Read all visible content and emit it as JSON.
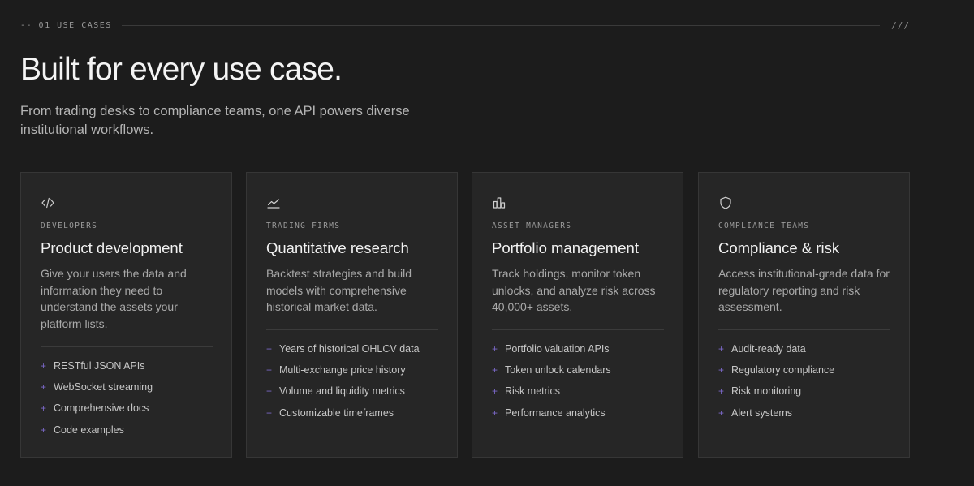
{
  "section": {
    "label": "-- 01 USE CASES",
    "mark": "///"
  },
  "hero": {
    "title": "Built for every use case.",
    "subtitle": "From trading desks to compliance teams, one API powers diverse institutional workflows."
  },
  "colors": {
    "background": "#1c1c1c",
    "card_background": "#262626",
    "accent": "#7b68c8"
  },
  "cards": [
    {
      "icon": "code-icon",
      "eyebrow": "DEVELOPERS",
      "title": "Product development",
      "description": "Give your users the data and information they need to understand the assets your platform lists.",
      "items": [
        "RESTful JSON APIs",
        "WebSocket streaming",
        "Comprehensive docs",
        "Code examples"
      ]
    },
    {
      "icon": "trend-chart-icon",
      "eyebrow": "TRADING FIRMS",
      "title": "Quantitative research",
      "description": "Backtest strategies and build models with comprehensive historical market data.",
      "items": [
        "Years of historical OHLCV data",
        "Multi-exchange price history",
        "Volume and liquidity metrics",
        "Customizable timeframes"
      ]
    },
    {
      "icon": "bar-chart-icon",
      "eyebrow": "ASSET MANAGERS",
      "title": "Portfolio management",
      "description": "Track holdings, monitor token unlocks, and analyze risk across 40,000+ assets.",
      "items": [
        "Portfolio valuation APIs",
        "Token unlock calendars",
        "Risk metrics",
        "Performance analytics"
      ]
    },
    {
      "icon": "shield-icon",
      "eyebrow": "COMPLIANCE TEAMS",
      "title": "Compliance & risk",
      "description": "Access institutional-grade data for regulatory reporting and risk assessment.",
      "items": [
        "Audit-ready data",
        "Regulatory compliance",
        "Risk monitoring",
        "Alert systems"
      ]
    }
  ],
  "bullet": "+"
}
